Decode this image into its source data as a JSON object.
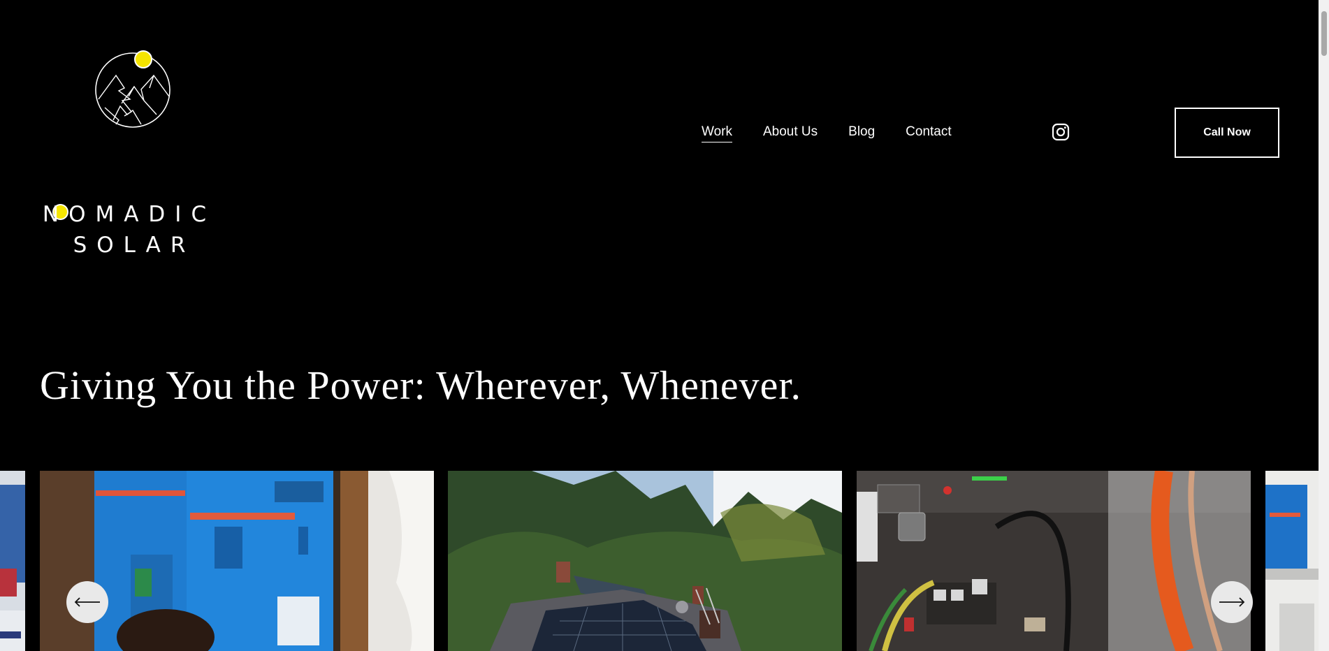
{
  "brand": {
    "line1": "NOMADIC",
    "line2": "SOLAR",
    "accent_color": "#f5e500"
  },
  "nav": {
    "items": [
      {
        "label": "Work",
        "active": true
      },
      {
        "label": "About Us",
        "active": false
      },
      {
        "label": "Blog",
        "active": false
      },
      {
        "label": "Contact",
        "active": false
      }
    ]
  },
  "social": {
    "icon": "instagram-icon"
  },
  "cta": {
    "label": "Call Now"
  },
  "hero": {
    "headline": "Giving You the Power: Wherever, Whenever."
  },
  "gallery": {
    "slides": [
      {
        "subject": "blue inverter units mounted on wooden wall"
      },
      {
        "subject": "solar panels on a house roof among redwood trees"
      },
      {
        "subject": "battery rack with power switch and cables"
      },
      {
        "subject": "blue charge controllers on white wall"
      },
      {
        "subject": "blue inverter equipment"
      }
    ],
    "prev_icon": "arrow-left-icon",
    "next_icon": "arrow-right-icon"
  }
}
